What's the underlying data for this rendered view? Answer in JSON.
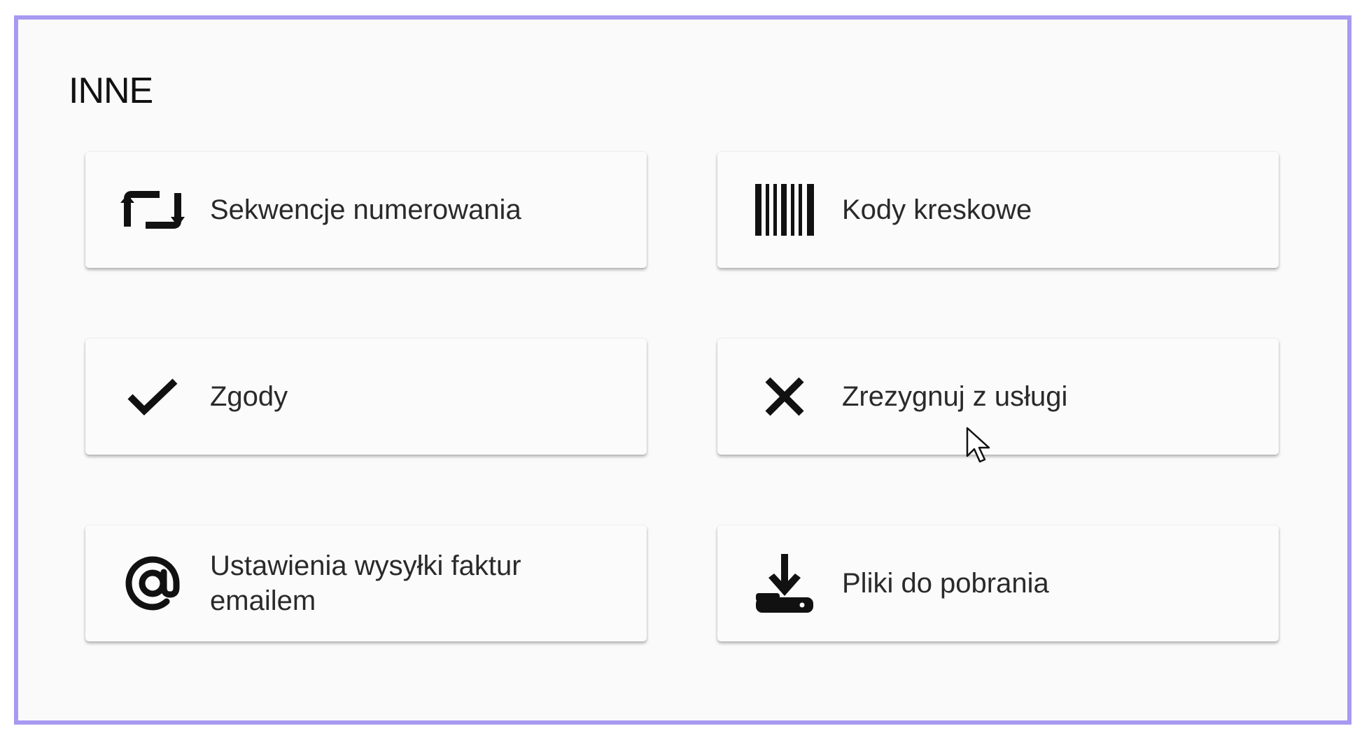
{
  "section": {
    "title": "INNE"
  },
  "cards": [
    {
      "label": "Sekwencje numerowania",
      "icon": "repeat-arrows-icon"
    },
    {
      "label": "Kody kreskowe",
      "icon": "barcode-icon"
    },
    {
      "label": "Zgody",
      "icon": "checkmark-icon"
    },
    {
      "label": "Zrezygnuj z usługi",
      "icon": "close-icon"
    },
    {
      "label": "Ustawienia wysyłki faktur emailem",
      "icon": "at-sign-icon"
    },
    {
      "label": "Pliki do pobrania",
      "icon": "download-icon"
    }
  ],
  "colors": {
    "frame_border": "#a79af0",
    "background": "#fafafa",
    "card": "#fbfbfb",
    "text": "#2a2a2a",
    "icon": "#111111"
  }
}
